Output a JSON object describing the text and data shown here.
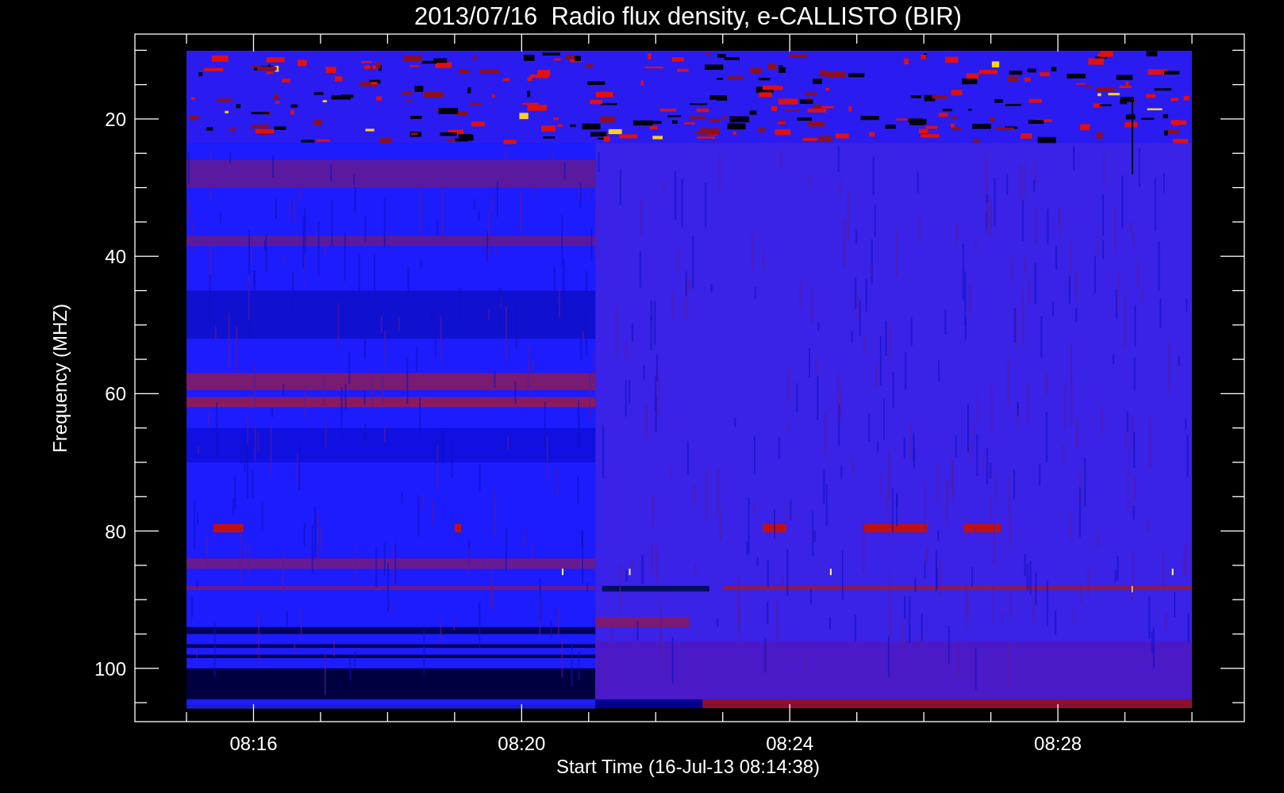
{
  "title": "2013/07/16  Radio flux density, e-CALLISTO (BIR)",
  "ylabel": "Frequency (MHZ)",
  "xlabel": "Start Time (16-Jul-13 08:14:38)",
  "yticks": [
    "20",
    "40",
    "60",
    "80",
    "100"
  ],
  "xticks": [
    "08:16",
    "08:20",
    "08:24",
    "08:28"
  ]
}
